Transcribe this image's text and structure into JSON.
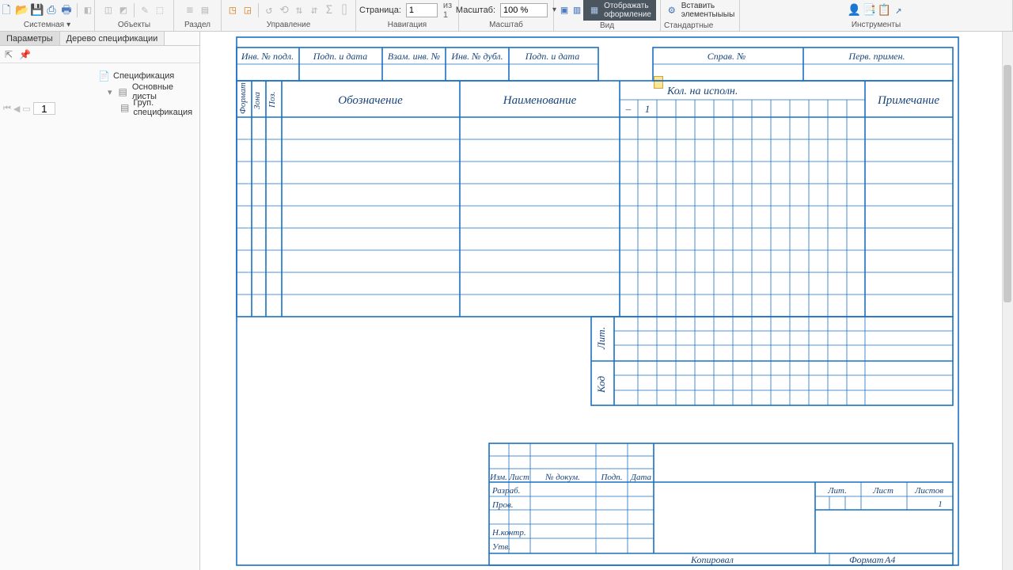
{
  "toolbar": {
    "groups": {
      "system": "Системная",
      "objects": "Объекты",
      "section": "Раздел",
      "manage": "Управление",
      "nav": "Навигация",
      "scale": "Масштаб",
      "view": "Вид",
      "std": "Стандартные изделия",
      "tools": "Инструменты"
    },
    "page_label": "Страница:",
    "page_value": "1",
    "page_of": "из 1",
    "scale_label": "Масштаб:",
    "scale_value": "100 %",
    "view_btn": "Отображать\nоформление",
    "insert_btn": "Вставить\nэлементыыыы"
  },
  "side": {
    "tab_params": "Параметры",
    "tab_tree": "Дерево спецификации",
    "tree": {
      "root": "Спецификация",
      "sheets": "Основные листы",
      "group": "Груп. спецификация"
    },
    "pager_value": "1"
  },
  "sheet": {
    "top_strip": {
      "c1": "Инв. № подл.",
      "c2": "Подп. и дата",
      "c3": "Взам. инв. №",
      "c4": "Инв. № дубл.",
      "c5": "Подп. и дата",
      "ref": "Справ. №",
      "first": "Перв. примен."
    },
    "columns": {
      "format": "Формат",
      "zone": "Зона",
      "pos": "Поз.",
      "desig": "Обозначение",
      "name": "Наименование",
      "qty": "Кол. на исполн.",
      "qty_dash": "–",
      "qty_1": "1",
      "note": "Примечание"
    },
    "side_labels": {
      "lit": "Лит.",
      "kod": "Код"
    },
    "title_block": {
      "izm": "Изм.",
      "list": "Лист",
      "docno": "№ докум.",
      "sign": "Подп.",
      "date": "Дата",
      "dev": "Разраб.",
      "check": "Пров.",
      "nctrl": "Н.контр.",
      "appr": "Утв.",
      "lit2": "Лит.",
      "sheet": "Лист",
      "sheets": "Листов",
      "sheets_val": "1",
      "copied": "Копировал",
      "format": "Формат",
      "fmtval": "А4"
    }
  }
}
